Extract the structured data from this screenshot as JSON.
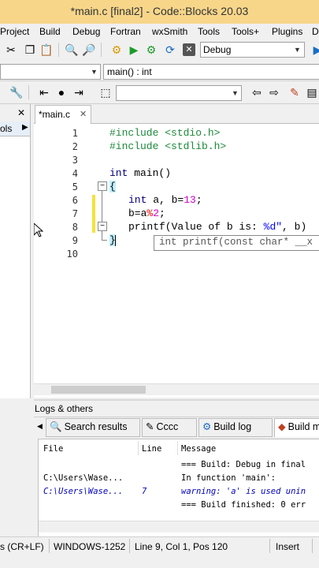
{
  "window": {
    "title": "*main.c [final2] - Code::Blocks 20.03"
  },
  "menu": [
    "Project",
    "Build",
    "Debug",
    "Fortran",
    "wxSmith",
    "Tools",
    "Tools+",
    "Plugins",
    "D"
  ],
  "toolbar": {
    "build_target": "Debug",
    "scope_value": "main() : int",
    "search_value": ""
  },
  "left_panel": {
    "tab_label": "ols"
  },
  "editor": {
    "tab_label": "*main.c",
    "line_numbers": [
      "1",
      "2",
      "3",
      "4",
      "5",
      "6",
      "7",
      "8",
      "9",
      "10"
    ],
    "lines": {
      "l1": "#include <stdio.h>",
      "l2": "#include <stdlib.h>",
      "l4a": "int",
      "l4b": " main()",
      "l5": "{",
      "l6a": "int",
      "l6b": " a, b=",
      "l6c": "13",
      "l6d": ";",
      "l7a": "b=a",
      "l7b": "%",
      "l7c": "2",
      "l7d": ";",
      "l8a": "printf(Value of b is: ",
      "l8b": "%d\"",
      "l8c": ", b)",
      "l9": "}"
    },
    "calltip": "int printf(const char* __x"
  },
  "logs": {
    "panel_title": "Logs & others",
    "tabs": [
      "Search results",
      "Cccc",
      "Build log",
      "Build m"
    ],
    "columns": [
      "File",
      "Line",
      "Message"
    ],
    "rows": [
      {
        "file": "",
        "line": "",
        "message": "=== Build: Debug in final"
      },
      {
        "file": "C:\\Users\\Wase...",
        "line": "",
        "message": "In function 'main':"
      },
      {
        "file": "C:\\Users\\Wase...",
        "line": "7",
        "message": "warning: 'a' is used unin"
      },
      {
        "file": "",
        "line": "",
        "message": "=== Build finished: 0 err"
      }
    ]
  },
  "statusbar": {
    "eol": "s (CR+LF)",
    "encoding": "WINDOWS-1252",
    "position": "Line 9, Col 1, Pos 120",
    "mode": "Insert"
  },
  "colors": {
    "titlebar": "#f7d68a",
    "warning_row": "#0000c0",
    "preprocessor": "#1d8a3a",
    "keyword": "#000080",
    "number": "#d000d0"
  }
}
